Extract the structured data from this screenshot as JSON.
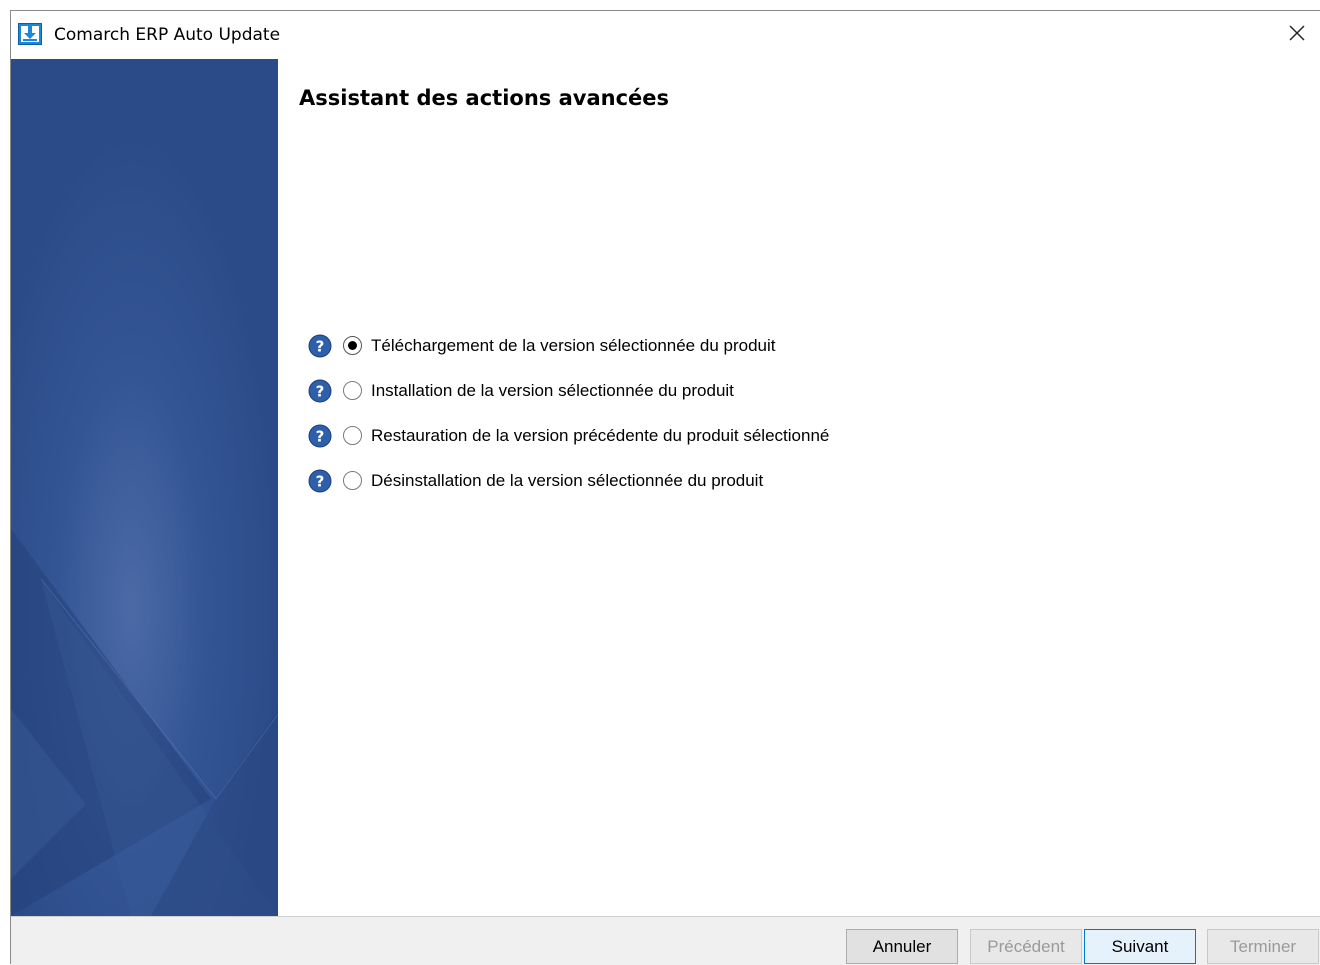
{
  "window": {
    "title": "Comarch ERP Auto Update"
  },
  "icons": {
    "app": "download-app-icon",
    "close": "close-icon",
    "help": "help-icon"
  },
  "colors": {
    "sidebar": "#2b4b88",
    "help_icon": "#2d5fab",
    "accent": "#0078d7"
  },
  "main": {
    "heading": "Assistant des actions avancées",
    "options": [
      {
        "label": "Téléchargement de la version sélectionnée du produit",
        "selected": true
      },
      {
        "label": "Installation de la version sélectionnée du produit",
        "selected": false
      },
      {
        "label": "Restauration de la version précédente du produit sélectionné",
        "selected": false
      },
      {
        "label": "Désinstallation de la version sélectionnée du produit",
        "selected": false
      }
    ]
  },
  "footer": {
    "cancel_label": "Annuler",
    "previous_label": "Précédent",
    "next_label": "Suivant",
    "finish_label": "Terminer"
  }
}
